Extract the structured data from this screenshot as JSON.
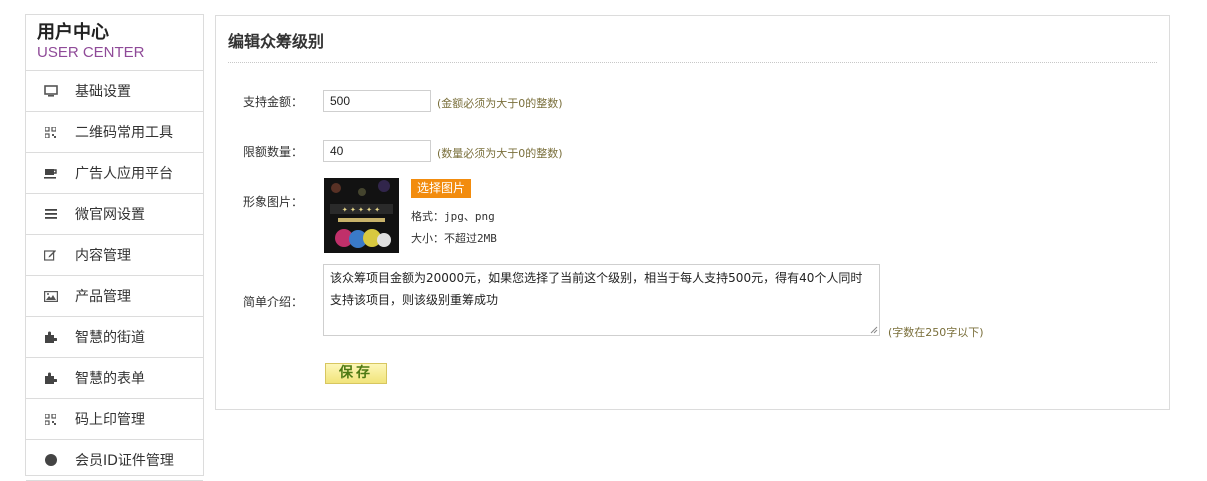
{
  "sidebar": {
    "title": "用户中心",
    "subtitle": "USER CENTER",
    "items": [
      {
        "label": "基础设置",
        "icon": "monitor-icon"
      },
      {
        "label": "二维码常用工具",
        "icon": "qrcode-icon"
      },
      {
        "label": "广告人应用平台",
        "icon": "cup-icon"
      },
      {
        "label": "微官网设置",
        "icon": "list-icon"
      },
      {
        "label": "内容管理",
        "icon": "edit-icon"
      },
      {
        "label": "产品管理",
        "icon": "image-icon"
      },
      {
        "label": "智慧的街道",
        "icon": "puzzle-icon"
      },
      {
        "label": "智慧的表单",
        "icon": "puzzle-icon"
      },
      {
        "label": "码上印管理",
        "icon": "qrcode-icon"
      },
      {
        "label": "会员ID证件管理",
        "icon": "circle-icon"
      }
    ]
  },
  "form": {
    "title": "编辑众筹级别",
    "amount_label": "支持金额：",
    "amount_value": "500",
    "amount_hint": "(金额必须为大于0的整数)",
    "quota_label": "限额数量：",
    "quota_value": "40",
    "quota_hint": "(数量必须为大于0的整数)",
    "image_label": "形象图片：",
    "pick_button": "选择图片",
    "format_text": "格式：jpg、png",
    "size_text": "大小：不超过2MB",
    "intro_label": "简单介绍：",
    "intro_value": "该众筹项目金额为20000元，如果您选择了当前这个级别，相当于每人支持500元，得有40个人同时支持该项目，则该级别重筹成功",
    "intro_hint": "(字数在250字以下)",
    "save_button": "保存"
  },
  "colors": {
    "accent_orange": "#f28c0e",
    "subtitle_purple": "#8f4a98",
    "hint_olive": "#7a6f3b"
  }
}
